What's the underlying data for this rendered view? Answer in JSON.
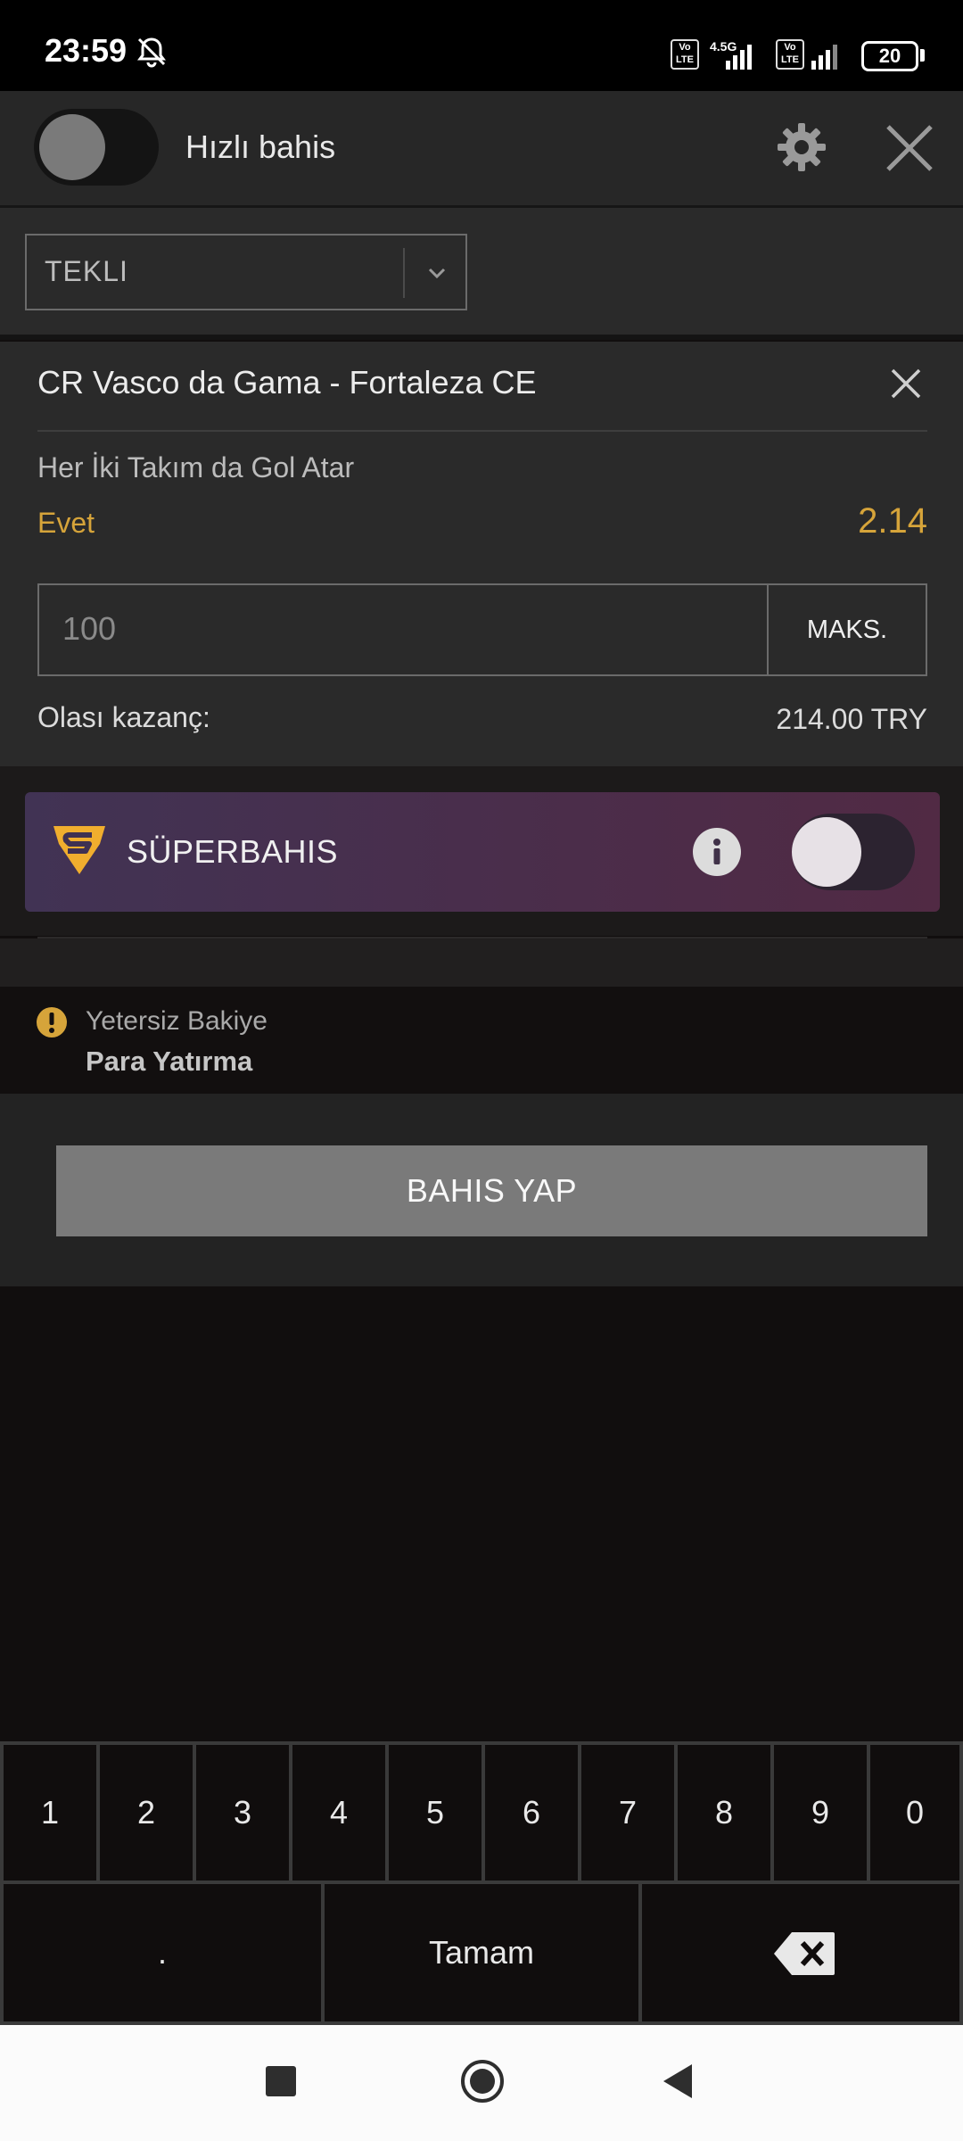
{
  "status_bar": {
    "time": "23:59",
    "sim1_badge": "Vo LTE",
    "network_type": "4.5G",
    "sim2_badge": "Vo LTE",
    "battery": "20",
    "icons": [
      "bell-muted-icon",
      "signal-icon",
      "battery-icon"
    ]
  },
  "header": {
    "quick_bet_label": "Hızlı bahis",
    "quick_bet_enabled": false,
    "icons": [
      "gear-icon",
      "close-icon"
    ]
  },
  "bet_type": {
    "selected": "TEKLI"
  },
  "bet": {
    "match": "CR Vasco da Gama - Fortaleza CE",
    "market": "Her İki Takım da Gol Atar",
    "selection": "Evet",
    "odds": "2.14",
    "stake_placeholder": "100",
    "max_label": "MAKS.",
    "winnings_label": "Olası kazanç:",
    "winnings_value": "214.00 TRY"
  },
  "superbahis": {
    "label": "SÜPERBAHIS",
    "enabled": false,
    "icons": [
      "superbahis-logo-icon",
      "info-icon"
    ]
  },
  "warning": {
    "title": "Yetersiz Bakiye",
    "action": "Para Yatırma"
  },
  "place_bet_label": "BAHIS YAP",
  "keypad": {
    "digits": [
      "1",
      "2",
      "3",
      "4",
      "5",
      "6",
      "7",
      "8",
      "9",
      "0"
    ],
    "decimal": ".",
    "done": "Tamam",
    "icons": [
      "backspace-icon"
    ]
  },
  "colors": {
    "accent_gold": "#d6a43a",
    "background": "#110e0e",
    "panel": "#2a2a2a",
    "superbahis_gradient_start": "#413354",
    "superbahis_gradient_end": "#512a44"
  }
}
